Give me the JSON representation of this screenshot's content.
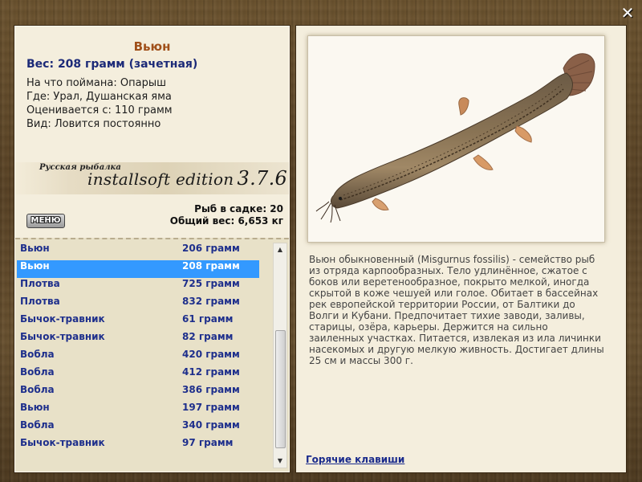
{
  "close_icon": "✕",
  "catch": {
    "name": "Вьюн",
    "weight_line": "Вес: 208 грамм (зачетная)",
    "details": [
      "На что поймана: Опарыш",
      "Где: Урал, Душанская яма",
      "Оценивается с: 110 грамм",
      "Вид: Ловится постоянно"
    ]
  },
  "logo": {
    "small_text": "Русская рыбалка",
    "edition_text": "installsoft edition",
    "version": "3.7.6"
  },
  "menu_label": "МЕНЮ",
  "stats": {
    "fish_count": "Рыб в садке: 20",
    "total_weight": "Общий вес: 6,653 кг"
  },
  "fish_list": [
    {
      "name": "Вьюн",
      "weight": "206 грамм",
      "selected": false
    },
    {
      "name": "Вьюн",
      "weight": "208 грамм",
      "selected": true
    },
    {
      "name": "Плотва",
      "weight": "725 грамм",
      "selected": false
    },
    {
      "name": "Плотва",
      "weight": "832 грамм",
      "selected": false
    },
    {
      "name": "Бычок-травник",
      "weight": "61 грамм",
      "selected": false
    },
    {
      "name": "Бычок-травник",
      "weight": "82 грамм",
      "selected": false
    },
    {
      "name": "Вобла",
      "weight": "420 грамм",
      "selected": false
    },
    {
      "name": "Вобла",
      "weight": "412 грамм",
      "selected": false
    },
    {
      "name": "Вобла",
      "weight": "386 грамм",
      "selected": false
    },
    {
      "name": "Вьюн",
      "weight": "197 грамм",
      "selected": false
    },
    {
      "name": "Вобла",
      "weight": "340 грамм",
      "selected": false
    },
    {
      "name": "Бычок-травник",
      "weight": "97 грамм",
      "selected": false
    }
  ],
  "scroll_icons": {
    "up": "▲",
    "down": "▼"
  },
  "description": "Вьюн обыкновенный (Misgurnus fossilis) - семейство рыб из отряда карпообразных. Тело удлинённое, сжатое с боков или веретенообразное, покрыто мелкой, иногда скрытой в коже чешуей или голое. Обитает в бассейнах рек европейской территории России, от Балтики до Волги и Кубани. Предпочитает тихие заводи, заливы, старицы, озёра, карьеры. Держится на сильно заиленных участках. Питается, извлекая из ила личинки насекомых и другую мелкую живность. Достигает длины 25 см и массы 300 г.",
  "hotkeys_label": "Горячие клавиши"
}
